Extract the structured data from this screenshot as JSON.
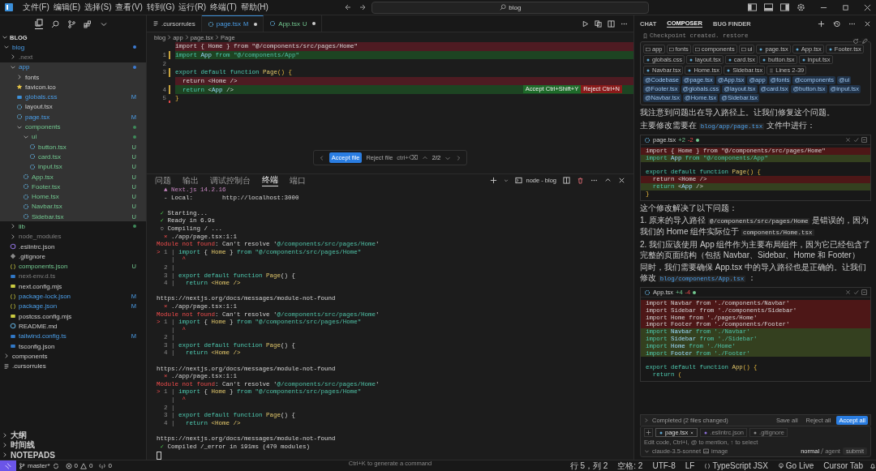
{
  "menu": [
    "文件(F)",
    "编辑(E)",
    "选择(S)",
    "查看(V)",
    "转到(G)",
    "运行(R)",
    "终端(T)",
    "帮助(H)"
  ],
  "search": {
    "value": "blog"
  },
  "explorer": {
    "title": "BLOG",
    "tree": [
      {
        "name": "blog",
        "kind": "folder",
        "modified": true,
        "untracked": false,
        "ignored": false,
        "highlighted": false,
        "dot": true,
        "expanded": true,
        "children": [
          {
            "name": ".next",
            "kind": "folder",
            "modified": false,
            "untracked": false,
            "ignored": true,
            "highlighted": false,
            "dot": false,
            "expanded": false
          },
          {
            "name": "app",
            "kind": "folder",
            "modified": true,
            "untracked": false,
            "ignored": false,
            "highlighted": true,
            "dot": true,
            "expanded": true,
            "children": [
              {
                "name": "fonts",
                "kind": "folder",
                "modified": false,
                "untracked": false,
                "ignored": false,
                "highlighted": true,
                "dot": false,
                "expanded": false
              },
              {
                "name": "favicon.ico",
                "kind": "star",
                "modified": false,
                "untracked": false,
                "ignored": false,
                "highlighted": true
              },
              {
                "name": "globals.css",
                "kind": "css",
                "modified": true,
                "untracked": false,
                "ignored": false,
                "highlighted": true,
                "badge": "M"
              },
              {
                "name": "layout.tsx",
                "kind": "react",
                "modified": false,
                "untracked": false,
                "ignored": false,
                "highlighted": true
              },
              {
                "name": "page.tsx",
                "kind": "react",
                "modified": true,
                "untracked": false,
                "ignored": false,
                "highlighted": true,
                "badge": "M"
              },
              {
                "name": "components",
                "kind": "folder",
                "modified": false,
                "untracked": true,
                "ignored": false,
                "highlighted": true,
                "dot": true,
                "expanded": true,
                "children": [
                  {
                    "name": "ui",
                    "kind": "folder",
                    "modified": false,
                    "untracked": true,
                    "ignored": false,
                    "highlighted": true,
                    "dot": true,
                    "expanded": true,
                    "children": [
                      {
                        "name": "button.tsx",
                        "kind": "react",
                        "modified": false,
                        "untracked": true,
                        "ignored": false,
                        "highlighted": true,
                        "badge": "U"
                      },
                      {
                        "name": "card.tsx",
                        "kind": "react",
                        "modified": false,
                        "untracked": true,
                        "ignored": false,
                        "highlighted": true,
                        "badge": "U"
                      },
                      {
                        "name": "input.tsx",
                        "kind": "react",
                        "modified": false,
                        "untracked": true,
                        "ignored": false,
                        "highlighted": true,
                        "badge": "U"
                      }
                    ]
                  },
                  {
                    "name": "App.tsx",
                    "kind": "react",
                    "modified": false,
                    "untracked": true,
                    "ignored": false,
                    "highlighted": true,
                    "badge": "U"
                  },
                  {
                    "name": "Footer.tsx",
                    "kind": "react",
                    "modified": false,
                    "untracked": true,
                    "ignored": false,
                    "highlighted": true,
                    "badge": "U"
                  },
                  {
                    "name": "Home.tsx",
                    "kind": "react",
                    "modified": false,
                    "untracked": true,
                    "ignored": false,
                    "highlighted": true,
                    "badge": "U"
                  },
                  {
                    "name": "Navbar.tsx",
                    "kind": "react",
                    "modified": false,
                    "untracked": true,
                    "ignored": false,
                    "highlighted": true,
                    "badge": "U"
                  },
                  {
                    "name": "Sidebar.tsx",
                    "kind": "react",
                    "modified": false,
                    "untracked": true,
                    "ignored": false,
                    "highlighted": true,
                    "badge": "U"
                  }
                ]
              }
            ]
          },
          {
            "name": "lib",
            "kind": "folder",
            "modified": false,
            "untracked": true,
            "ignored": false,
            "highlighted": false,
            "dot": true,
            "expanded": false
          },
          {
            "name": "node_modules",
            "kind": "folder",
            "modified": false,
            "untracked": false,
            "ignored": true,
            "highlighted": false,
            "dot": false,
            "expanded": false
          },
          {
            "name": ".eslintrc.json",
            "kind": "eslint",
            "modified": false,
            "untracked": false,
            "ignored": false,
            "highlighted": false
          },
          {
            "name": ".gitignore",
            "kind": "git",
            "modified": false,
            "untracked": false,
            "ignored": false,
            "highlighted": false
          },
          {
            "name": "components.json",
            "kind": "json",
            "modified": false,
            "untracked": true,
            "ignored": false,
            "highlighted": false,
            "badge": "U"
          },
          {
            "name": "next-env.d.ts",
            "kind": "ts",
            "modified": false,
            "untracked": false,
            "ignored": true,
            "highlighted": false
          },
          {
            "name": "next.config.mjs",
            "kind": "js",
            "modified": false,
            "untracked": false,
            "ignored": false,
            "highlighted": false
          },
          {
            "name": "package-lock.json",
            "kind": "json",
            "modified": true,
            "untracked": false,
            "ignored": false,
            "highlighted": false,
            "badge": "M"
          },
          {
            "name": "package.json",
            "kind": "json",
            "modified": true,
            "untracked": false,
            "ignored": false,
            "highlighted": false,
            "badge": "M"
          },
          {
            "name": "postcss.config.mjs",
            "kind": "js",
            "modified": false,
            "untracked": false,
            "ignored": false,
            "highlighted": false
          },
          {
            "name": "README.md",
            "kind": "info",
            "modified": false,
            "untracked": false,
            "ignored": false,
            "highlighted": false
          },
          {
            "name": "tailwind.config.ts",
            "kind": "ts",
            "modified": true,
            "untracked": false,
            "ignored": false,
            "highlighted": false,
            "badge": "M"
          },
          {
            "name": "tsconfig.json",
            "kind": "tsconfig",
            "modified": false,
            "untracked": false,
            "ignored": false,
            "highlighted": false
          }
        ]
      },
      {
        "name": "components",
        "kind": "folder",
        "modified": false,
        "untracked": false,
        "ignored": false,
        "highlighted": false,
        "dot": false,
        "expanded": false
      },
      {
        "name": ".cursorrules",
        "kind": "rules",
        "modified": false,
        "untracked": false,
        "ignored": false,
        "highlighted": false
      }
    ],
    "sections": [
      "大纲",
      "时间线",
      "NOTEPADS"
    ]
  },
  "editor": {
    "tabs": [
      {
        "label": ".cursorrules",
        "kind": "rules",
        "modified": false,
        "untracked": false,
        "selected": false
      },
      {
        "label": "page.tsx",
        "kind": "react",
        "modified": true,
        "untracked": false,
        "badge": "M",
        "dirty": true,
        "selected": true
      },
      {
        "label": "App.tsx",
        "kind": "react",
        "modified": false,
        "untracked": true,
        "badge": "U",
        "dirty": true,
        "selected": false
      }
    ],
    "breadcrumb": [
      "blog",
      "app",
      "page.tsx",
      "Page"
    ],
    "lines": [
      {
        "kind": "removed",
        "tokens": [
          {
            "text": "import { Home } from \"@/components/src/pages/Home\"",
            "kind": "plain"
          }
        ]
      },
      {
        "num": "1",
        "kind": "added",
        "tokens": [
          {
            "text": "import",
            "kind": "kw"
          },
          {
            "text": " App ",
            "kind": "var"
          },
          {
            "text": "from",
            "kind": "kw"
          },
          {
            "text": " \"@/components/App\"",
            "kind": "str"
          }
        ]
      },
      {
        "num": "2",
        "kind": "none"
      },
      {
        "num": "3",
        "kind": "changed",
        "tokens": [
          {
            "text": "export default function",
            "kind": "kw"
          },
          {
            "text": " Page",
            "kind": "fn"
          },
          {
            "text": "() {",
            "kind": "punc"
          }
        ]
      },
      {
        "kind": "removed",
        "tokens": [
          {
            "text": "  return <Home />",
            "kind": "plain"
          }
        ]
      },
      {
        "num": "4",
        "kind": "added",
        "tokens": [
          {
            "text": "  return",
            "kind": "kw"
          },
          {
            "text": " <",
            "kind": "plain"
          },
          {
            "text": "App",
            "kind": "var"
          },
          {
            "text": " />",
            "kind": "plain"
          }
        ],
        "actions": [
          {
            "label": "Accept Ctrl+Shift+Y",
            "kind": "accept"
          },
          {
            "label": "Reject Ctrl+N",
            "kind": "reject"
          }
        ]
      },
      {
        "num": "5",
        "kind": "deletion",
        "tokens": [
          {
            "text": "}",
            "kind": "punc"
          }
        ]
      }
    ],
    "review": {
      "accept": "Accept file",
      "reject": "Reject file",
      "reject_key": "ctrl+⌫",
      "counter": "2/2"
    }
  },
  "terminal": {
    "tabs": [
      {
        "label": "问题",
        "selected": false
      },
      {
        "label": "输出",
        "selected": false
      },
      {
        "label": "调试控制台",
        "selected": false
      },
      {
        "label": "终端",
        "selected": true
      },
      {
        "label": "端口",
        "selected": false
      }
    ],
    "instance": "node - blog",
    "lines": [
      {
        "kind": "text",
        "tokens": [
          {
            "text": "  ▲ Next.js 14.2.16",
            "kind": "accent"
          }
        ]
      },
      {
        "kind": "text",
        "tokens": [
          {
            "text": "  - Local:        http://localhost:3000",
            "kind": "plain"
          }
        ]
      },
      {
        "kind": "blank"
      },
      {
        "kind": "text",
        "tokens": [
          {
            "text": " ✓",
            "kind": "ok"
          },
          {
            "text": " Starting...",
            "kind": "plain"
          }
        ]
      },
      {
        "kind": "text",
        "tokens": [
          {
            "text": " ✓",
            "kind": "ok"
          },
          {
            "text": " Ready in 6.9s",
            "kind": "plain"
          }
        ]
      },
      {
        "kind": "text",
        "tokens": [
          {
            "text": " ○ Compiling / ...",
            "kind": "plain"
          }
        ]
      },
      {
        "kind": "text",
        "tokens": [
          {
            "text": "  ⨯",
            "kind": "err"
          },
          {
            "text": " ./app/page.tsx:1:1",
            "kind": "plain"
          }
        ]
      },
      {
        "kind": "text",
        "tokens": [
          {
            "text": "Module not found",
            "kind": "err"
          },
          {
            "text": ": Can't resolve '",
            "kind": "plain"
          },
          {
            "text": "@/components/src/pages/Home",
            "kind": "str"
          },
          {
            "text": "'",
            "kind": "plain"
          }
        ]
      },
      {
        "kind": "text",
        "tokens": [
          {
            "text": "> ",
            "kind": "err"
          },
          {
            "text": "1 | ",
            "kind": "muted"
          },
          {
            "text": "import",
            "kind": "kw"
          },
          {
            "text": " { ",
            "kind": "plain"
          },
          {
            "text": "Home",
            "kind": "fn"
          },
          {
            "text": " } ",
            "kind": "plain"
          },
          {
            "text": "from",
            "kind": "kw"
          },
          {
            "text": " \"@/components/src/pages/Home\"",
            "kind": "str"
          }
        ]
      },
      {
        "kind": "text",
        "tokens": [
          {
            "text": "    | ",
            "kind": "muted"
          },
          {
            "text": " ^",
            "kind": "err"
          }
        ]
      },
      {
        "kind": "text",
        "tokens": [
          {
            "text": "  2 |",
            "kind": "muted"
          }
        ]
      },
      {
        "kind": "text",
        "tokens": [
          {
            "text": "  3 | ",
            "kind": "muted"
          },
          {
            "text": "export default function",
            "kind": "kw"
          },
          {
            "text": " Page",
            "kind": "fn"
          },
          {
            "text": "() {",
            "kind": "plain"
          }
        ]
      },
      {
        "kind": "text",
        "tokens": [
          {
            "text": "  4 | ",
            "kind": "muted"
          },
          {
            "text": "  return",
            "kind": "kw"
          },
          {
            "text": " <Home />",
            "kind": "fn"
          }
        ]
      },
      {
        "kind": "blank"
      },
      {
        "kind": "text",
        "tokens": [
          {
            "text": "https://nextjs.org/docs/messages/module-not-found",
            "kind": "plain"
          }
        ]
      },
      {
        "kind": "text",
        "tokens": [
          {
            "text": "  ⨯",
            "kind": "err"
          },
          {
            "text": " ./app/page.tsx:1:1",
            "kind": "plain"
          }
        ]
      },
      {
        "kind": "text",
        "tokens": [
          {
            "text": "Module not found",
            "kind": "err"
          },
          {
            "text": ": Can't resolve '",
            "kind": "plain"
          },
          {
            "text": "@/components/src/pages/Home",
            "kind": "str"
          },
          {
            "text": "'",
            "kind": "plain"
          }
        ]
      },
      {
        "kind": "text",
        "tokens": [
          {
            "text": "> ",
            "kind": "err"
          },
          {
            "text": "1 | ",
            "kind": "muted"
          },
          {
            "text": "import",
            "kind": "kw"
          },
          {
            "text": " { ",
            "kind": "plain"
          },
          {
            "text": "Home",
            "kind": "fn"
          },
          {
            "text": " } ",
            "kind": "plain"
          },
          {
            "text": "from",
            "kind": "kw"
          },
          {
            "text": " \"@/components/src/pages/Home\"",
            "kind": "str"
          }
        ]
      },
      {
        "kind": "text",
        "tokens": [
          {
            "text": "    | ",
            "kind": "muted"
          },
          {
            "text": " ^",
            "kind": "err"
          }
        ]
      },
      {
        "kind": "text",
        "tokens": [
          {
            "text": "  2 |",
            "kind": "muted"
          }
        ]
      },
      {
        "kind": "text",
        "tokens": [
          {
            "text": "  3 | ",
            "kind": "muted"
          },
          {
            "text": "export default function",
            "kind": "kw"
          },
          {
            "text": " Page",
            "kind": "fn"
          },
          {
            "text": "() {",
            "kind": "plain"
          }
        ]
      },
      {
        "kind": "text",
        "tokens": [
          {
            "text": "  4 | ",
            "kind": "muted"
          },
          {
            "text": "  return",
            "kind": "kw"
          },
          {
            "text": " <Home />",
            "kind": "fn"
          }
        ]
      },
      {
        "kind": "blank"
      },
      {
        "kind": "text",
        "tokens": [
          {
            "text": "https://nextjs.org/docs/messages/module-not-found",
            "kind": "plain"
          }
        ]
      },
      {
        "kind": "text",
        "tokens": [
          {
            "text": "  ⨯",
            "kind": "err"
          },
          {
            "text": " ./app/page.tsx:1:1",
            "kind": "plain"
          }
        ]
      },
      {
        "kind": "text",
        "tokens": [
          {
            "text": "Module not found",
            "kind": "err"
          },
          {
            "text": ": Can't resolve '",
            "kind": "plain"
          },
          {
            "text": "@/components/src/pages/Home",
            "kind": "str"
          },
          {
            "text": "'",
            "kind": "plain"
          }
        ]
      },
      {
        "kind": "text",
        "tokens": [
          {
            "text": "> ",
            "kind": "err"
          },
          {
            "text": "1 | ",
            "kind": "muted"
          },
          {
            "text": "import",
            "kind": "kw"
          },
          {
            "text": " { ",
            "kind": "plain"
          },
          {
            "text": "Home",
            "kind": "fn"
          },
          {
            "text": " } ",
            "kind": "plain"
          },
          {
            "text": "from",
            "kind": "kw"
          },
          {
            "text": " \"@/components/src/pages/Home\"",
            "kind": "str"
          }
        ]
      },
      {
        "kind": "text",
        "tokens": [
          {
            "text": "    | ",
            "kind": "muted"
          },
          {
            "text": " ^",
            "kind": "err"
          }
        ]
      },
      {
        "kind": "text",
        "tokens": [
          {
            "text": "  2 |",
            "kind": "muted"
          }
        ]
      },
      {
        "kind": "text",
        "tokens": [
          {
            "text": "  3 | ",
            "kind": "muted"
          },
          {
            "text": "export default function",
            "kind": "kw"
          },
          {
            "text": " Page",
            "kind": "fn"
          },
          {
            "text": "() {",
            "kind": "plain"
          }
        ]
      },
      {
        "kind": "text",
        "tokens": [
          {
            "text": "  4 | ",
            "kind": "muted"
          },
          {
            "text": "  return",
            "kind": "kw"
          },
          {
            "text": " <Home />",
            "kind": "fn"
          }
        ]
      },
      {
        "kind": "blank"
      },
      {
        "kind": "text",
        "tokens": [
          {
            "text": "https://nextjs.org/docs/messages/module-not-found",
            "kind": "plain"
          }
        ]
      },
      {
        "kind": "text",
        "tokens": [
          {
            "text": " ✓",
            "kind": "ok"
          },
          {
            "text": " Compiled /_error in 191ms (470 modules)",
            "kind": "plain"
          }
        ]
      }
    ],
    "hint": "Ctrl+K to generate a command"
  },
  "composer": {
    "tabs": [
      {
        "label": "CHAT",
        "selected": false
      },
      {
        "label": "COMPOSER",
        "selected": true
      },
      {
        "label": "BUG FINDER",
        "selected": false
      }
    ],
    "checkpoint": "Checkpoint created. restore",
    "context": [
      {
        "label": "app",
        "kind": "folder"
      },
      {
        "label": "fonts",
        "kind": "folder"
      },
      {
        "label": "components",
        "kind": "folder"
      },
      {
        "label": "ui",
        "kind": "folder"
      },
      {
        "label": "page.tsx",
        "kind": "file"
      },
      {
        "label": "App.tsx",
        "kind": "file"
      },
      {
        "label": "Footer.tsx",
        "kind": "file"
      },
      {
        "label": "globals.css",
        "kind": "file"
      },
      {
        "label": "layout.tsx",
        "kind": "file"
      },
      {
        "label": "card.tsx",
        "kind": "file"
      },
      {
        "label": "button.tsx",
        "kind": "file"
      },
      {
        "label": "input.tsx",
        "kind": "file"
      },
      {
        "label": "Navbar.tsx",
        "kind": "file"
      },
      {
        "label": "Home.tsx",
        "kind": "file"
      },
      {
        "label": "Sidebar.tsx",
        "kind": "file"
      },
      {
        "label": "Lines 2-39",
        "kind": "lines"
      }
    ],
    "mentions": [
      "@Codebase",
      "@page.tsx",
      "@App.tsx",
      "@app",
      "@fonts",
      "@components",
      "@ui",
      "@Footer.tsx",
      "@globals.css",
      "@layout.tsx",
      "@card.tsx",
      "@button.tsx",
      "@input.tsx",
      "@Navbar.tsx",
      "@Home.tsx",
      "@Sidebar.tsx"
    ],
    "messages": [
      {
        "kind": "text",
        "parts": [
          {
            "text": "我注意到问题出在导入路径上。让我们修复这个问题。",
            "kind": "text"
          }
        ]
      },
      {
        "kind": "text",
        "parts": [
          {
            "text": "主要修改需要在 ",
            "kind": "text"
          },
          {
            "text": "blog/app/page.tsx",
            "kind": "path"
          },
          {
            "text": " 文件中进行：",
            "kind": "text"
          }
        ]
      },
      {
        "kind": "code",
        "file": "page.tsx",
        "added": "+2",
        "removed": "-2",
        "lines": [
          {
            "kind": "removed",
            "tokens": [
              {
                "text": "import { Home } from \"@/components/src/pages/Home\"",
                "kind": "plain"
              }
            ]
          },
          {
            "kind": "added",
            "tokens": [
              {
                "text": "import",
                "kind": "kw"
              },
              {
                "text": " App ",
                "kind": "var"
              },
              {
                "text": "from",
                "kind": "kw"
              },
              {
                "text": " \"@/components/App\"",
                "kind": "str"
              }
            ]
          },
          {
            "kind": "none"
          },
          {
            "kind": "none",
            "tokens": [
              {
                "text": "export default function",
                "kind": "kw"
              },
              {
                "text": " Page",
                "kind": "fn"
              },
              {
                "text": "() {",
                "kind": "punc"
              }
            ]
          },
          {
            "kind": "removed",
            "tokens": [
              {
                "text": "  return <Home />",
                "kind": "plain"
              }
            ]
          },
          {
            "kind": "added",
            "tokens": [
              {
                "text": "  return",
                "kind": "kw"
              },
              {
                "text": " <",
                "kind": "plain"
              },
              {
                "text": "App",
                "kind": "var"
              },
              {
                "text": " />",
                "kind": "plain"
              }
            ]
          },
          {
            "kind": "none",
            "tokens": [
              {
                "text": "}",
                "kind": "punc"
              }
            ]
          }
        ]
      },
      {
        "kind": "text",
        "parts": [
          {
            "text": "这个修改解决了以下问题：",
            "kind": "text"
          }
        ]
      },
      {
        "kind": "text",
        "parts": [
          {
            "text": "1. 原来的导入路径 ",
            "kind": "text"
          },
          {
            "text": "@/components/src/pages/Home",
            "kind": "code"
          },
          {
            "text": " 是错误的，因为我们的 Home 组件实际位于 ",
            "kind": "text"
          },
          {
            "text": "components/Home.tsx",
            "kind": "code"
          }
        ]
      },
      {
        "kind": "text",
        "parts": [
          {
            "text": "2. 我们应该使用 App 组件作为主要布局组件，因为它已经包含了完整的页面结构（包括 Navbar、Sidebar、Home 和 Footer）",
            "kind": "text"
          }
        ]
      },
      {
        "kind": "text",
        "parts": [
          {
            "text": "同时，我们需要确保 App.tsx 中的导入路径也是正确的。让我们修改 ",
            "kind": "text"
          },
          {
            "text": "blog/components/App.tsx",
            "kind": "path"
          },
          {
            "text": " ：",
            "kind": "text"
          }
        ]
      },
      {
        "kind": "code",
        "file": "App.tsx",
        "added": "+4",
        "removed": "-4",
        "lines": [
          {
            "kind": "removed",
            "tokens": [
              {
                "text": "import Navbar from './components/Navbar'",
                "kind": "plain"
              }
            ]
          },
          {
            "kind": "removed",
            "tokens": [
              {
                "text": "import Sidebar from './components/Sidebar'",
                "kind": "plain"
              }
            ]
          },
          {
            "kind": "removed",
            "tokens": [
              {
                "text": "import Home from './pages/Home'",
                "kind": "plain"
              }
            ]
          },
          {
            "kind": "removed",
            "tokens": [
              {
                "text": "import Footer from './components/Footer'",
                "kind": "plain"
              }
            ]
          },
          {
            "kind": "added",
            "tokens": [
              {
                "text": "import",
                "kind": "kw"
              },
              {
                "text": " Navbar ",
                "kind": "var"
              },
              {
                "text": "from",
                "kind": "kw"
              },
              {
                "text": " './Navbar'",
                "kind": "str"
              }
            ]
          },
          {
            "kind": "added",
            "tokens": [
              {
                "text": "import",
                "kind": "kw"
              },
              {
                "text": " Sidebar ",
                "kind": "var"
              },
              {
                "text": "from",
                "kind": "kw"
              },
              {
                "text": " './Sidebar'",
                "kind": "str"
              }
            ]
          },
          {
            "kind": "added",
            "tokens": [
              {
                "text": "import",
                "kind": "kw"
              },
              {
                "text": " Home ",
                "kind": "var"
              },
              {
                "text": "from",
                "kind": "kw"
              },
              {
                "text": " './Home'",
                "kind": "str"
              }
            ]
          },
          {
            "kind": "added",
            "tokens": [
              {
                "text": "import",
                "kind": "kw"
              },
              {
                "text": " Footer ",
                "kind": "var"
              },
              {
                "text": "from",
                "kind": "kw"
              },
              {
                "text": " './Footer'",
                "kind": "str"
              }
            ]
          },
          {
            "kind": "none"
          },
          {
            "kind": "none",
            "tokens": [
              {
                "text": "export default function",
                "kind": "kw"
              },
              {
                "text": " App",
                "kind": "fn"
              },
              {
                "text": "() {",
                "kind": "punc"
              }
            ]
          },
          {
            "kind": "none",
            "tokens": [
              {
                "text": "  return",
                "kind": "kw"
              },
              {
                "text": " (",
                "kind": "punc"
              }
            ]
          }
        ]
      }
    ],
    "completed": {
      "label": "Completed (2 files changed)",
      "actions": [
        {
          "label": "Save all",
          "kind": "plain"
        },
        {
          "label": "Reject all",
          "kind": "plain"
        },
        {
          "label": "Accept all",
          "kind": "primary"
        }
      ]
    },
    "attachments": [
      {
        "label": "page.tsx",
        "kind": "react",
        "selected": true
      },
      {
        "label": ".eslintrc.json",
        "kind": "eslint",
        "selected": false
      },
      {
        "label": ".gitignore",
        "kind": "git",
        "selected": false
      }
    ],
    "placeholder": "Edit code, Ctrl+I, @ to mention, ↑ to select",
    "model": "claude-3.5-sonnet",
    "image": "image",
    "modes": [
      {
        "label": "normal",
        "selected": true
      },
      {
        "label": "agent",
        "selected": false
      }
    ],
    "submit": "submit"
  },
  "status": {
    "branch": "master*",
    "errors": "0",
    "warnings": "0",
    "ports": "0",
    "right": [
      {
        "label": "行 5，列 2",
        "kind": "plain"
      },
      {
        "label": "空格: 2",
        "kind": "plain"
      },
      {
        "label": "UTF-8",
        "kind": "plain"
      },
      {
        "label": "LF",
        "kind": "plain"
      },
      {
        "label": "TypeScript JSX",
        "kind": "language"
      },
      {
        "label": "Go Live",
        "kind": "live"
      },
      {
        "label": "Cursor Tab",
        "kind": "plain"
      }
    ]
  }
}
